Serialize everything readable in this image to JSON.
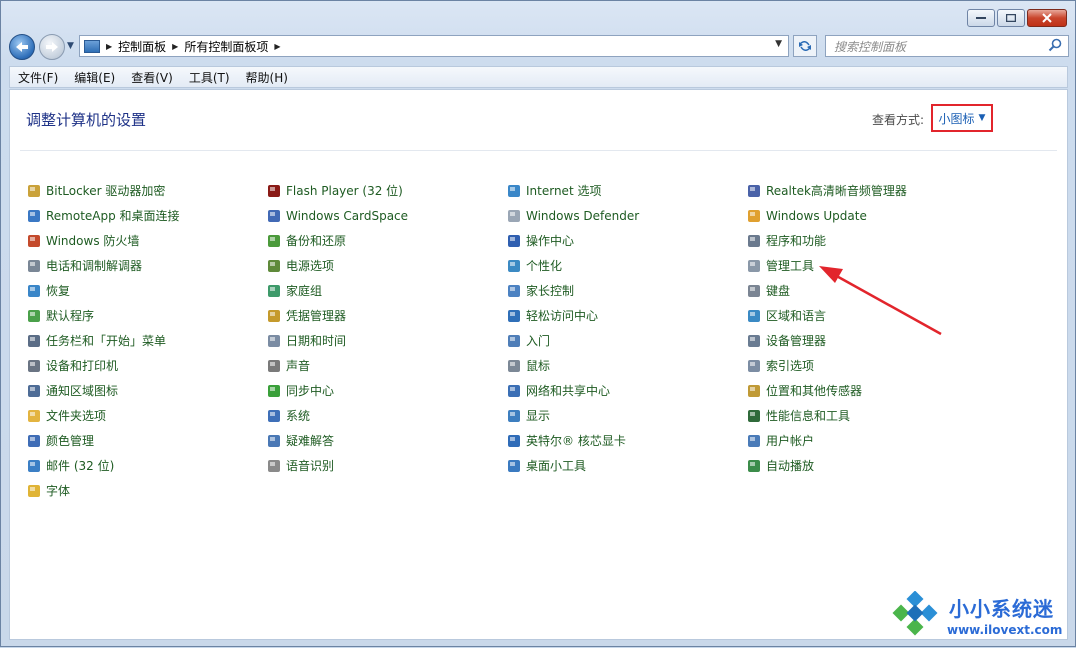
{
  "address": {
    "crumbs": [
      "控制面板",
      "所有控制面板项"
    ]
  },
  "search": {
    "placeholder": "搜索控制面板"
  },
  "menu": [
    "文件(F)",
    "编辑(E)",
    "查看(V)",
    "工具(T)",
    "帮助(H)"
  ],
  "header": {
    "title": "调整计算机的设置",
    "view_by_label": "查看方式:",
    "view_by_value": "小图标"
  },
  "columns": [
    [
      {
        "label": "BitLocker 驱动器加密",
        "icon": "bitlocker-icon",
        "color": "#caa23a"
      },
      {
        "label": "RemoteApp 和桌面连接",
        "icon": "remoteapp-icon",
        "color": "#3a78c4"
      },
      {
        "label": "Windows 防火墙",
        "icon": "firewall-icon",
        "color": "#c44a2c"
      },
      {
        "label": "电话和调制解调器",
        "icon": "phone-modem-icon",
        "color": "#7a8796"
      },
      {
        "label": "恢复",
        "icon": "recovery-icon",
        "color": "#3a86c8"
      },
      {
        "label": "默认程序",
        "icon": "default-programs-icon",
        "color": "#4aa04a"
      },
      {
        "label": "任务栏和「开始」菜单",
        "icon": "taskbar-icon",
        "color": "#5b6d86"
      },
      {
        "label": "设备和打印机",
        "icon": "printer-icon",
        "color": "#6a7483"
      },
      {
        "label": "通知区域图标",
        "icon": "notification-icon",
        "color": "#4e6c96"
      },
      {
        "label": "文件夹选项",
        "icon": "folder-options-icon",
        "color": "#e3b440"
      },
      {
        "label": "颜色管理",
        "icon": "color-management-icon",
        "color": "#3f6db6"
      },
      {
        "label": "邮件 (32 位)",
        "icon": "mail-icon",
        "color": "#3b7fc5"
      },
      {
        "label": "字体",
        "icon": "fonts-icon",
        "color": "#e0b436"
      }
    ],
    [
      {
        "label": "Flash Player (32 位)",
        "icon": "flash-player-icon",
        "color": "#8a1a16"
      },
      {
        "label": "Windows CardSpace",
        "icon": "cardspace-icon",
        "color": "#4169b5"
      },
      {
        "label": "备份和还原",
        "icon": "backup-icon",
        "color": "#4b9a3b"
      },
      {
        "label": "电源选项",
        "icon": "power-options-icon",
        "color": "#5f8a3a"
      },
      {
        "label": "家庭组",
        "icon": "homegroup-icon",
        "color": "#3e9a6a"
      },
      {
        "label": "凭据管理器",
        "icon": "credential-manager-icon",
        "color": "#c59a2c"
      },
      {
        "label": "日期和时间",
        "icon": "date-time-icon",
        "color": "#7b8ca3"
      },
      {
        "label": "声音",
        "icon": "sound-icon",
        "color": "#7a7a7a"
      },
      {
        "label": "同步中心",
        "icon": "sync-center-icon",
        "color": "#3aa03a"
      },
      {
        "label": "系统",
        "icon": "system-icon",
        "color": "#3e6fb8"
      },
      {
        "label": "疑难解答",
        "icon": "troubleshooting-icon",
        "color": "#4a78b5"
      },
      {
        "label": "语音识别",
        "icon": "speech-recognition-icon",
        "color": "#8a8a8a"
      }
    ],
    [
      {
        "label": "Internet 选项",
        "icon": "internet-options-icon",
        "color": "#3a87c8"
      },
      {
        "label": "Windows Defender",
        "icon": "defender-icon",
        "color": "#9aa6b5"
      },
      {
        "label": "操作中心",
        "icon": "action-center-icon",
        "color": "#2f5fb0"
      },
      {
        "label": "个性化",
        "icon": "personalization-icon",
        "color": "#3b8ac3"
      },
      {
        "label": "家长控制",
        "icon": "parental-controls-icon",
        "color": "#4c82c2"
      },
      {
        "label": "轻松访问中心",
        "icon": "ease-of-access-icon",
        "color": "#2f6fb8"
      },
      {
        "label": "入门",
        "icon": "getting-started-icon",
        "color": "#4f7eb8"
      },
      {
        "label": "鼠标",
        "icon": "mouse-icon",
        "color": "#7c8896"
      },
      {
        "label": "网络和共享中心",
        "icon": "network-sharing-icon",
        "color": "#3b6fb5"
      },
      {
        "label": "显示",
        "icon": "display-icon",
        "color": "#3d7ebf"
      },
      {
        "label": "英特尔® 核芯显卡",
        "icon": "intel-graphics-icon",
        "color": "#2f6cb8"
      },
      {
        "label": "桌面小工具",
        "icon": "gadgets-icon",
        "color": "#3a7ac0"
      }
    ],
    [
      {
        "label": "Realtek高清晰音频管理器",
        "icon": "realtek-audio-icon",
        "color": "#4a62a8"
      },
      {
        "label": "Windows Update",
        "icon": "windows-update-icon",
        "color": "#e0a030"
      },
      {
        "label": "程序和功能",
        "icon": "programs-features-icon",
        "color": "#6b7a8e"
      },
      {
        "label": "管理工具",
        "icon": "admin-tools-icon",
        "color": "#8a98a8"
      },
      {
        "label": "键盘",
        "icon": "keyboard-icon",
        "color": "#7b8593"
      },
      {
        "label": "区域和语言",
        "icon": "region-language-icon",
        "color": "#3a8ac4"
      },
      {
        "label": "设备管理器",
        "icon": "device-manager-icon",
        "color": "#6a7c92"
      },
      {
        "label": "索引选项",
        "icon": "indexing-icon",
        "color": "#7c8da3"
      },
      {
        "label": "位置和其他传感器",
        "icon": "location-sensors-icon",
        "color": "#c09a36"
      },
      {
        "label": "性能信息和工具",
        "icon": "performance-icon",
        "color": "#2f6a3a"
      },
      {
        "label": "用户帐户",
        "icon": "user-accounts-icon",
        "color": "#4a7bb8"
      },
      {
        "label": "自动播放",
        "icon": "autoplay-icon",
        "color": "#3b8c4a"
      }
    ]
  ],
  "watermark": {
    "name": "小小系统迷",
    "url": "www.ilovext.com"
  },
  "colors": {
    "title": "#1e3287",
    "link": "#1e5b22",
    "highlight": "#e2252c"
  }
}
